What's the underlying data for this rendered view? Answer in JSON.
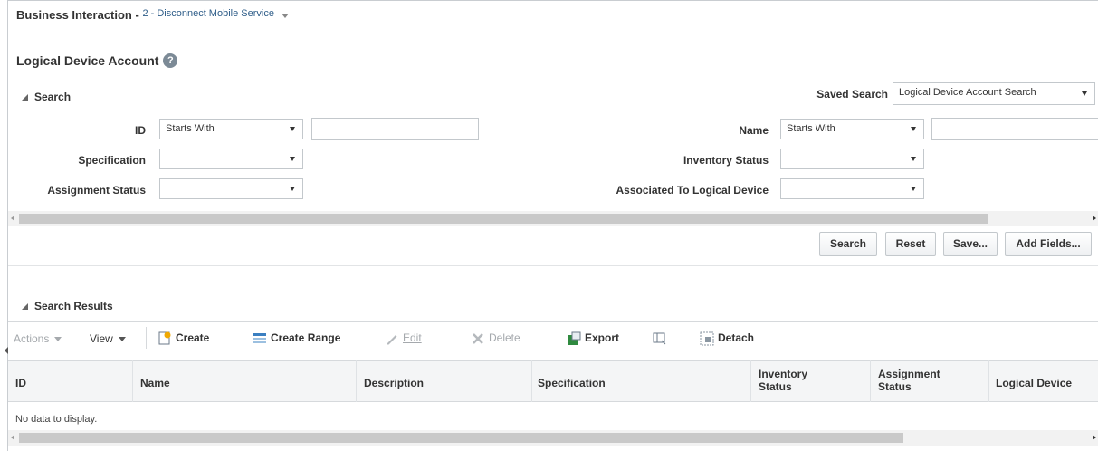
{
  "header": {
    "title": "Business Interaction",
    "separator": " - ",
    "context_link": "2 - Disconnect Mobile Service"
  },
  "page": {
    "title": "Logical Device Account",
    "help_glyph": "?"
  },
  "search": {
    "section_label": "Search",
    "saved_search_label": "Saved Search",
    "saved_search_value": "Logical Device Account Search",
    "fields": {
      "id_label": "ID",
      "id_operator": "Starts With",
      "id_value": "",
      "name_label": "Name",
      "name_operator": "Starts With",
      "name_value": "",
      "specification_label": "Specification",
      "specification_value": "",
      "inventory_status_label": "Inventory Status",
      "inventory_status_value": "",
      "assignment_status_label": "Assignment Status",
      "assignment_status_value": "",
      "associated_label": "Associated To Logical Device",
      "associated_value": ""
    },
    "buttons": {
      "search": "Search",
      "reset": "Reset",
      "save": "Save...",
      "add_fields": "Add Fields..."
    }
  },
  "results": {
    "section_label": "Search Results",
    "toolbar": {
      "actions": "Actions",
      "view": "View",
      "create": "Create",
      "create_range": "Create Range",
      "edit": "Edit",
      "delete": "Delete",
      "export": "Export",
      "detach": "Detach"
    },
    "columns": [
      {
        "line1": "ID",
        "line2": ""
      },
      {
        "line1": "Name",
        "line2": ""
      },
      {
        "line1": "Description",
        "line2": ""
      },
      {
        "line1": "Specification",
        "line2": ""
      },
      {
        "line1": "Inventory",
        "line2": "Status"
      },
      {
        "line1": "Assignment",
        "line2": "Status"
      },
      {
        "line1": "Logical Device",
        "line2": ""
      }
    ],
    "empty_message": "No data to display."
  },
  "colors": {
    "link": "#2d5c88",
    "border": "#c3c8cc",
    "table_header_bg": "#f4f5f6",
    "scroll_thumb": "#c9c9c9"
  },
  "icons": {
    "help": "help-icon",
    "disclose": "disclosure-triangle-icon",
    "create": "create-icon",
    "create_range": "create-range-icon",
    "edit": "pencil-icon",
    "delete": "delete-x-icon",
    "export": "export-icon",
    "freeze": "freeze-column-icon",
    "detach": "detach-icon"
  }
}
